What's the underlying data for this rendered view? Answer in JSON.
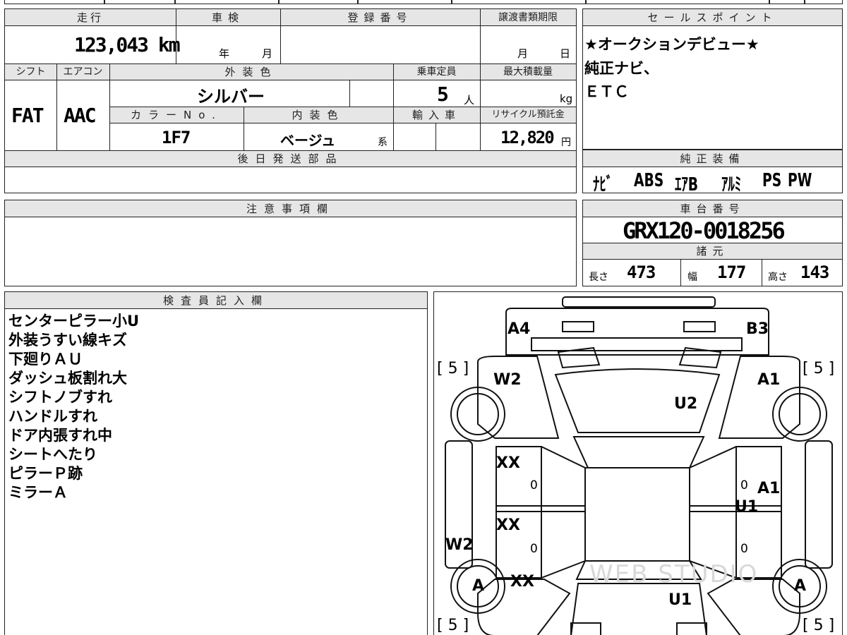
{
  "top_block": {
    "headers": {
      "mileage": "走行",
      "inspection": "車検",
      "registration_no": "登録番号",
      "transfer_deadline": "譲渡書類期限"
    },
    "mileage_value": "123,043 km",
    "inspection_year_unit": "年",
    "inspection_month_unit": "月",
    "transfer_month_unit": "月",
    "transfer_day_unit": "日",
    "headers2": {
      "shift": "シフト",
      "aircon": "エアコン",
      "exterior_color": "外装色",
      "capacity": "乗車定員",
      "max_load": "最大積載量"
    },
    "shift_value": "FAT",
    "aircon_value": "AAC",
    "exterior_color_value": "シルバー",
    "capacity_value": "5",
    "capacity_unit": "人",
    "max_load_unit": "kg",
    "headers3": {
      "color_no": "カラーNo.",
      "interior_color": "内装色",
      "import": "輸入車",
      "recycle_fee": "リサイクル預託金"
    },
    "color_no_value": "1F7",
    "interior_color_value": "ベージュ",
    "interior_color_suffix": "系",
    "recycle_fee_value": "12,820",
    "recycle_fee_unit": "円",
    "later_parts_header": "後日発送部品"
  },
  "sales_points": {
    "header": "セールスポイント",
    "lines": [
      "★オークションデビュー★",
      "純正ナビ、",
      "ＥＴＣ"
    ]
  },
  "genuine_equipment": {
    "header": "純正装備",
    "items": [
      "ﾅﾋﾞ",
      "ABS",
      "ｴｱB",
      "ｱﾙﾐ",
      "PS",
      "PW"
    ]
  },
  "caution": {
    "header": "注意事項欄"
  },
  "chassis": {
    "header": "車台番号",
    "value": "GRX120-0018256"
  },
  "specs": {
    "header": "諸元",
    "length_label": "長さ",
    "length_value": "473",
    "width_label": "幅",
    "width_value": "177",
    "height_label": "高さ",
    "height_value": "143"
  },
  "inspector": {
    "header": "検査員記入欄",
    "notes": [
      "センターピラー小U",
      "外装うすい線キズ",
      "下廻りＡＵ",
      "ダッシュ板割れ大",
      "シフトノブすれ",
      "ハンドルすれ",
      "ドア内張すれ中",
      "シートへたり",
      "ピラーＰ跡",
      "ミラーＡ"
    ]
  },
  "car_map": {
    "marks": {
      "front_left_corner": "A4",
      "front_right_corner": "B3",
      "front_left_fender": "W2",
      "front_right_fender": "A1",
      "hood": "U2",
      "left_front_door": "XX",
      "left_rear_door": "XX",
      "right_front_door": "A1",
      "right_pillar": "U1",
      "left_sill": "W2",
      "rear_left_quarter": "XX",
      "trunk": "U1",
      "wheel_rear_left": "A",
      "wheel_rear_right": "A"
    },
    "tires": {
      "front_left": "[ 5 ]",
      "front_right": "[ 5 ]",
      "rear_left": "[ 5 ]",
      "rear_right": "[ 5 ]"
    },
    "zero_marks": [
      "0",
      "0",
      "0",
      "0"
    ],
    "watermark": "WEB STUDIO"
  }
}
